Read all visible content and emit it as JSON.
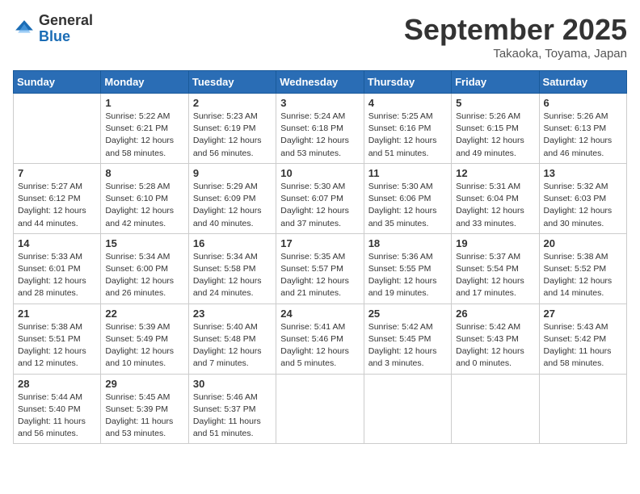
{
  "header": {
    "logo_general": "General",
    "logo_blue": "Blue",
    "month_title": "September 2025",
    "location": "Takaoka, Toyama, Japan"
  },
  "columns": [
    "Sunday",
    "Monday",
    "Tuesday",
    "Wednesday",
    "Thursday",
    "Friday",
    "Saturday"
  ],
  "weeks": [
    [
      {
        "day": "",
        "info": ""
      },
      {
        "day": "1",
        "info": "Sunrise: 5:22 AM\nSunset: 6:21 PM\nDaylight: 12 hours\nand 58 minutes."
      },
      {
        "day": "2",
        "info": "Sunrise: 5:23 AM\nSunset: 6:19 PM\nDaylight: 12 hours\nand 56 minutes."
      },
      {
        "day": "3",
        "info": "Sunrise: 5:24 AM\nSunset: 6:18 PM\nDaylight: 12 hours\nand 53 minutes."
      },
      {
        "day": "4",
        "info": "Sunrise: 5:25 AM\nSunset: 6:16 PM\nDaylight: 12 hours\nand 51 minutes."
      },
      {
        "day": "5",
        "info": "Sunrise: 5:26 AM\nSunset: 6:15 PM\nDaylight: 12 hours\nand 49 minutes."
      },
      {
        "day": "6",
        "info": "Sunrise: 5:26 AM\nSunset: 6:13 PM\nDaylight: 12 hours\nand 46 minutes."
      }
    ],
    [
      {
        "day": "7",
        "info": "Sunrise: 5:27 AM\nSunset: 6:12 PM\nDaylight: 12 hours\nand 44 minutes."
      },
      {
        "day": "8",
        "info": "Sunrise: 5:28 AM\nSunset: 6:10 PM\nDaylight: 12 hours\nand 42 minutes."
      },
      {
        "day": "9",
        "info": "Sunrise: 5:29 AM\nSunset: 6:09 PM\nDaylight: 12 hours\nand 40 minutes."
      },
      {
        "day": "10",
        "info": "Sunrise: 5:30 AM\nSunset: 6:07 PM\nDaylight: 12 hours\nand 37 minutes."
      },
      {
        "day": "11",
        "info": "Sunrise: 5:30 AM\nSunset: 6:06 PM\nDaylight: 12 hours\nand 35 minutes."
      },
      {
        "day": "12",
        "info": "Sunrise: 5:31 AM\nSunset: 6:04 PM\nDaylight: 12 hours\nand 33 minutes."
      },
      {
        "day": "13",
        "info": "Sunrise: 5:32 AM\nSunset: 6:03 PM\nDaylight: 12 hours\nand 30 minutes."
      }
    ],
    [
      {
        "day": "14",
        "info": "Sunrise: 5:33 AM\nSunset: 6:01 PM\nDaylight: 12 hours\nand 28 minutes."
      },
      {
        "day": "15",
        "info": "Sunrise: 5:34 AM\nSunset: 6:00 PM\nDaylight: 12 hours\nand 26 minutes."
      },
      {
        "day": "16",
        "info": "Sunrise: 5:34 AM\nSunset: 5:58 PM\nDaylight: 12 hours\nand 24 minutes."
      },
      {
        "day": "17",
        "info": "Sunrise: 5:35 AM\nSunset: 5:57 PM\nDaylight: 12 hours\nand 21 minutes."
      },
      {
        "day": "18",
        "info": "Sunrise: 5:36 AM\nSunset: 5:55 PM\nDaylight: 12 hours\nand 19 minutes."
      },
      {
        "day": "19",
        "info": "Sunrise: 5:37 AM\nSunset: 5:54 PM\nDaylight: 12 hours\nand 17 minutes."
      },
      {
        "day": "20",
        "info": "Sunrise: 5:38 AM\nSunset: 5:52 PM\nDaylight: 12 hours\nand 14 minutes."
      }
    ],
    [
      {
        "day": "21",
        "info": "Sunrise: 5:38 AM\nSunset: 5:51 PM\nDaylight: 12 hours\nand 12 minutes."
      },
      {
        "day": "22",
        "info": "Sunrise: 5:39 AM\nSunset: 5:49 PM\nDaylight: 12 hours\nand 10 minutes."
      },
      {
        "day": "23",
        "info": "Sunrise: 5:40 AM\nSunset: 5:48 PM\nDaylight: 12 hours\nand 7 minutes."
      },
      {
        "day": "24",
        "info": "Sunrise: 5:41 AM\nSunset: 5:46 PM\nDaylight: 12 hours\nand 5 minutes."
      },
      {
        "day": "25",
        "info": "Sunrise: 5:42 AM\nSunset: 5:45 PM\nDaylight: 12 hours\nand 3 minutes."
      },
      {
        "day": "26",
        "info": "Sunrise: 5:42 AM\nSunset: 5:43 PM\nDaylight: 12 hours\nand 0 minutes."
      },
      {
        "day": "27",
        "info": "Sunrise: 5:43 AM\nSunset: 5:42 PM\nDaylight: 11 hours\nand 58 minutes."
      }
    ],
    [
      {
        "day": "28",
        "info": "Sunrise: 5:44 AM\nSunset: 5:40 PM\nDaylight: 11 hours\nand 56 minutes."
      },
      {
        "day": "29",
        "info": "Sunrise: 5:45 AM\nSunset: 5:39 PM\nDaylight: 11 hours\nand 53 minutes."
      },
      {
        "day": "30",
        "info": "Sunrise: 5:46 AM\nSunset: 5:37 PM\nDaylight: 11 hours\nand 51 minutes."
      },
      {
        "day": "",
        "info": ""
      },
      {
        "day": "",
        "info": ""
      },
      {
        "day": "",
        "info": ""
      },
      {
        "day": "",
        "info": ""
      }
    ]
  ]
}
